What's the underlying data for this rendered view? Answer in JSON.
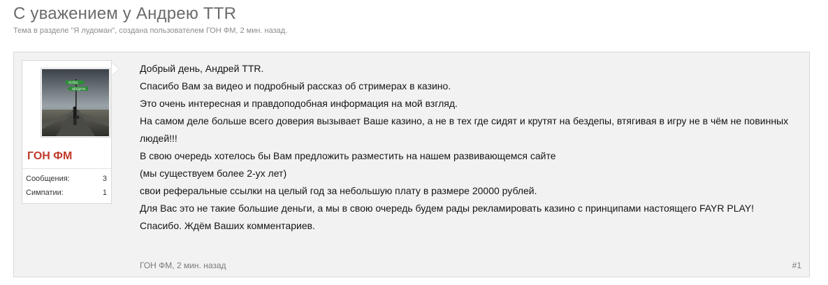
{
  "thread": {
    "title": "С уважением у Андрею TTR",
    "meta": "Тема в разделе \"Я лудоман\", создана пользователем ГОН ФМ, 2 мин. назад."
  },
  "post": {
    "user": {
      "name": "ГОН ФМ",
      "avatar_icon": "road-crossroads-signpost-avatar",
      "avatar_sign_top": "УСПЕХ",
      "avatar_sign_bottom": "НЕУДАЧА",
      "stats": [
        {
          "label": "Сообщения:",
          "value": "3"
        },
        {
          "label": "Симпатии:",
          "value": "1"
        }
      ]
    },
    "body_lines": [
      "Добрый день, Андрей TTR.",
      "Спасибо Вам за видео и подробный рассказ об стримерах в казино.",
      "Это очень интересная и правдоподобная информация на мой взгляд.",
      "На самом деле больше всего доверия вызывает Ваше казино, а не в тех где сидят и крутят на бездепы, втягивая в игру не в чём не повинных людей!!!",
      "В свою очередь хотелось бы Вам предложить разместить на нашем развивающемся сайте",
      "(мы существуем более 2-ух лет)",
      "свои реферальные ссылки на целый год за небольшую плату в размере 20000 рублей.",
      "Для Вас это не такие большие деньги, а мы в свою очередь будем рады рекламировать казино с принципами настоящего FAYR PLAY!",
      "Спасибо. Ждём Ваших комментариев."
    ],
    "footer_author": "ГОН ФМ",
    "footer_time": "2 мин. назад",
    "footer_separator": ", ",
    "number": "#1"
  },
  "colors": {
    "title": "#6b6b6b",
    "username": "#c0392b",
    "message_bg": "#f2f2f2",
    "border": "#d8d8d8"
  }
}
